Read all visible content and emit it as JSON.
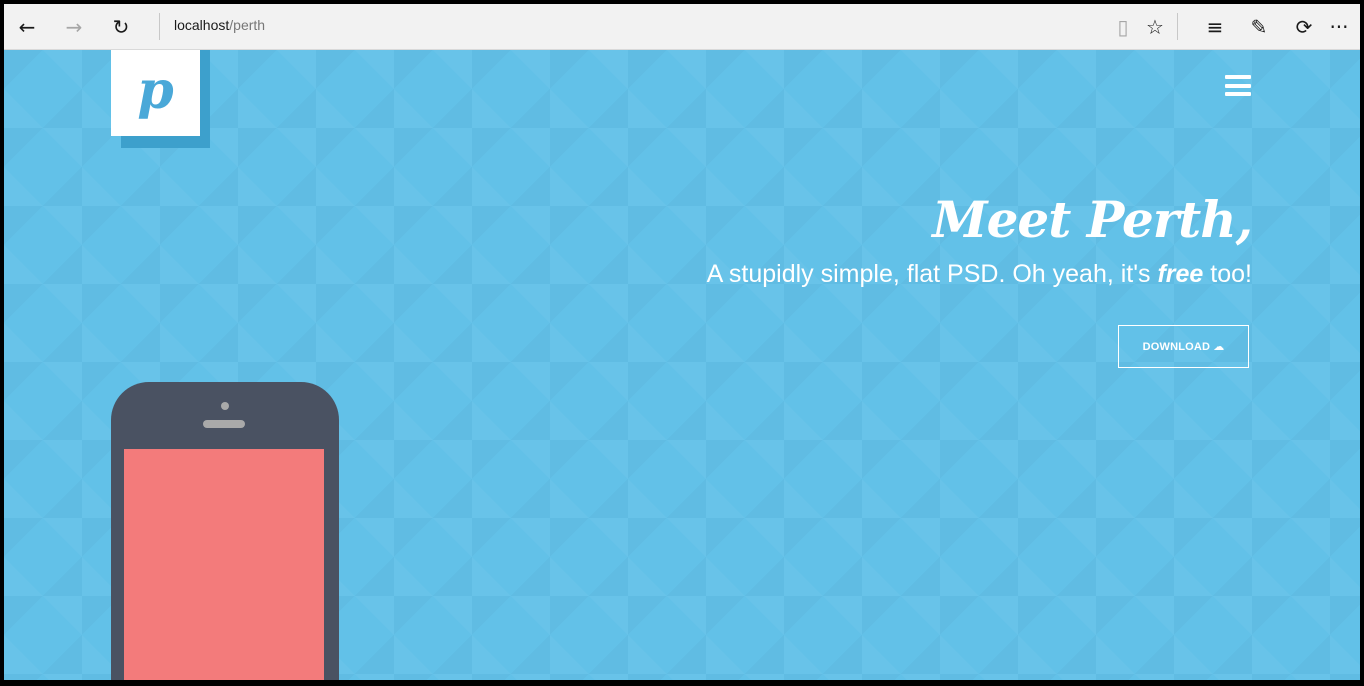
{
  "browser": {
    "back_icon": "←",
    "forward_icon": "→",
    "refresh_icon": "↻",
    "address_host": "localhost",
    "address_path": "/perth",
    "reading_view_icon": "▯",
    "favorite_icon": "☆",
    "hub_icon": "≡",
    "web_note_icon": "✎",
    "share_icon": "⟳",
    "more_icon": "···"
  },
  "page": {
    "logo_letter": "p",
    "headline": "Meet Perth,",
    "subline_prefix": "A stupidly simple, flat PSD. Oh yeah, it's ",
    "subline_emphasis": "free",
    "subline_suffix": " too!",
    "download_label": "DOWNLOAD",
    "download_icon": "☁",
    "colors": {
      "background": "#62c1e8",
      "phone_body": "#4a5262",
      "phone_screen": "#f37b7b",
      "logo_letter": "#4aa8d8"
    }
  }
}
